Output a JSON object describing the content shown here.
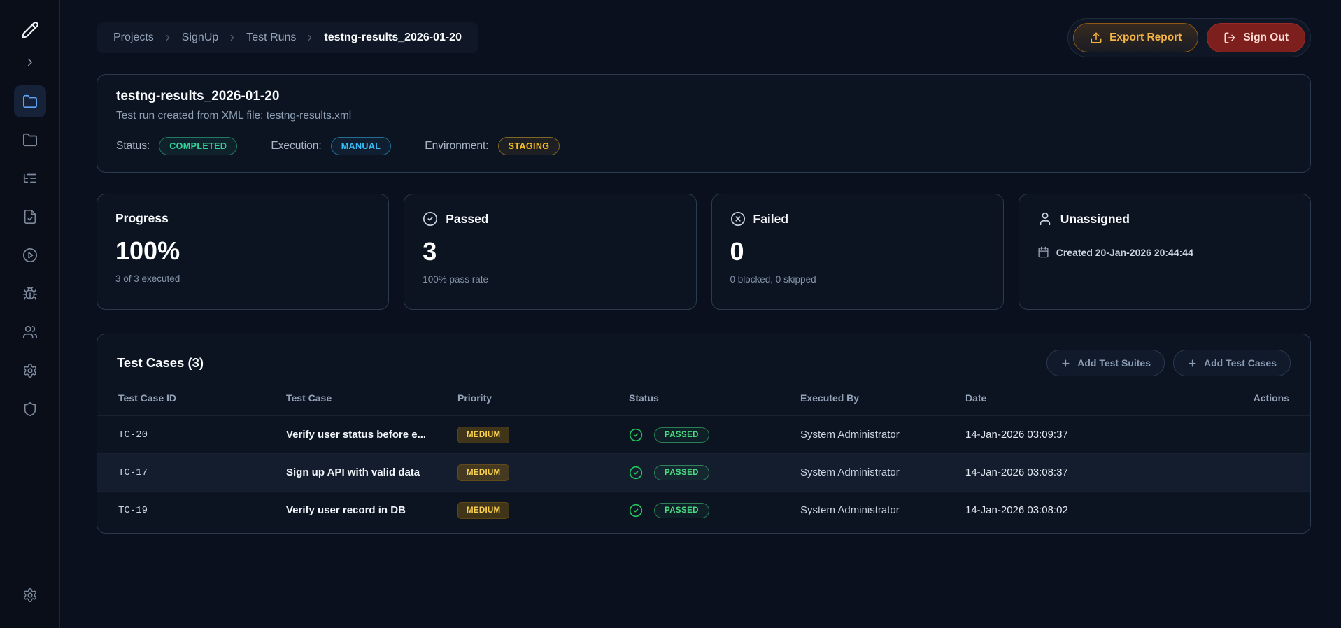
{
  "colors": {
    "green": "#34d399",
    "blue": "#38bdf8",
    "amber": "#fbbf24",
    "red": "#f87171"
  },
  "sidebar": {
    "icons": [
      "pencil-logo",
      "chevron-right",
      "folder-active",
      "folder",
      "list-tree",
      "file",
      "play-circle",
      "bug",
      "users",
      "settings",
      "shield",
      "settings-bottom"
    ]
  },
  "header": {
    "breadcrumb": [
      "Projects",
      "SignUp",
      "Test Runs",
      "testng-results_2026-01-20"
    ],
    "export_button": "Export Report",
    "signout_button": "Sign Out"
  },
  "run_info": {
    "title": "testng-results_2026-01-20",
    "subtitle": "Test run created from XML file: testng-results.xml",
    "status_label": "Status:",
    "status_value": "COMPLETED",
    "execution_label": "Execution:",
    "execution_value": "MANUAL",
    "environment_label": "Environment:",
    "environment_value": "STAGING"
  },
  "stats": {
    "progress": {
      "title": "Progress",
      "value": "100%",
      "subtitle": "3 of 3 executed"
    },
    "passed": {
      "title": "Passed",
      "value": "3",
      "subtitle": "100% pass rate"
    },
    "failed": {
      "title": "Failed",
      "value": "0",
      "subtitle": "0 blocked, 0 skipped"
    },
    "unassigned": {
      "title": "Unassigned",
      "created": "Created 20-Jan-2026 20:44:44"
    }
  },
  "test_cases": {
    "title": "Test Cases (3)",
    "add_suites_button": "Add Test Suites",
    "add_cases_button": "Add Test Cases",
    "columns": [
      "Test Case ID",
      "Test Case",
      "Priority",
      "Status",
      "Executed By",
      "Date",
      "Actions"
    ],
    "rows": [
      {
        "id": "TC-20",
        "name": "Verify user status before e...",
        "priority": "MEDIUM",
        "status": "PASSED",
        "executed_by": "System Administrator",
        "date": "14-Jan-2026 03:09:37"
      },
      {
        "id": "TC-17",
        "name": "Sign up API with valid data",
        "priority": "MEDIUM",
        "status": "PASSED",
        "executed_by": "System Administrator",
        "date": "14-Jan-2026 03:08:37"
      },
      {
        "id": "TC-19",
        "name": "Verify user record in DB",
        "priority": "MEDIUM",
        "status": "PASSED",
        "executed_by": "System Administrator",
        "date": "14-Jan-2026 03:08:02"
      }
    ]
  }
}
